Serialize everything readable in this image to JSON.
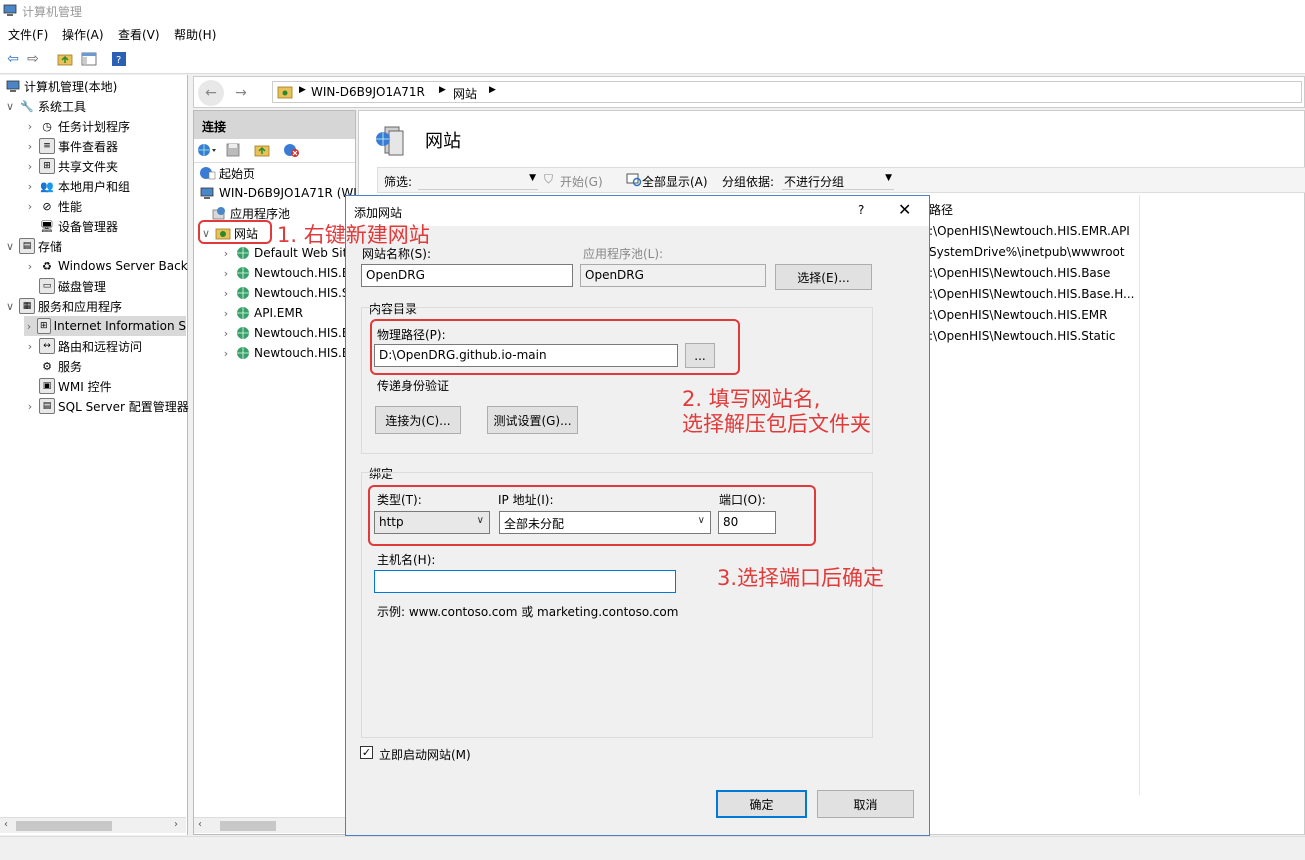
{
  "window": {
    "title": "计算机管理"
  },
  "menu": [
    {
      "label": "文件(F)"
    },
    {
      "label": "操作(A)"
    },
    {
      "label": "查看(V)"
    },
    {
      "label": "帮助(H)"
    }
  ],
  "left_tree": {
    "root": "计算机管理(本地)",
    "system_tools": "系统工具",
    "task_scheduler": "任务计划程序",
    "event_viewer": "事件查看器",
    "shared_folders": "共享文件夹",
    "local_users": "本地用户和组",
    "performance": "性能",
    "device_manager": "设备管理器",
    "storage": "存储",
    "windows_backup": "Windows Server Back",
    "disk_mgmt": "磁盘管理",
    "services_apps": "服务和应用程序",
    "iis": "Internet Information S",
    "routing": "路由和远程访问",
    "services": "服务",
    "wmi": "WMI 控件",
    "sql": "SQL Server 配置管理器"
  },
  "address": {
    "server": "WIN-D6B9JO1A71R",
    "node": "网站"
  },
  "connections": {
    "header": "连接",
    "start_page": "起始页",
    "server": "WIN-D6B9JO1A71R (WI",
    "app_pools": "应用程序池",
    "sites": "网站",
    "site_items": [
      "Default Web Sit",
      "Newtouch.HIS.E",
      "Newtouch.HIS.S",
      "API.EMR",
      "Newtouch.HIS.E",
      "Newtouch.HIS.E"
    ]
  },
  "right": {
    "title": "网站",
    "filter_label": "筛选:",
    "start_label": "开始(G)",
    "show_all_label": "全部显示(A)",
    "group_by_label": "分组依据:",
    "group_by_value": "不进行分组",
    "path_header": "路径",
    "paths": [
      ":\\OpenHIS\\Newtouch.HIS.EMR.API",
      "SystemDrive%\\inetpub\\wwwroot",
      ":\\OpenHIS\\Newtouch.HIS.Base",
      ":\\OpenHIS\\Newtouch.HIS.Base.H...",
      ":\\OpenHIS\\Newtouch.HIS.EMR",
      ":\\OpenHIS\\Newtouch.HIS.Static"
    ]
  },
  "dialog": {
    "title": "添加网站",
    "help": "?",
    "site_name_label": "网站名称(S):",
    "site_name_value": "OpenDRG",
    "app_pool_label": "应用程序池(L):",
    "app_pool_value": "OpenDRG",
    "select_button": "选择(E)...",
    "content_dir_label": "内容目录",
    "physical_path_label": "物理路径(P):",
    "physical_path_value": "D:\\OpenDRG.github.io-main",
    "browse_button": "...",
    "passthrough_label": "传递身份验证",
    "connect_as_button": "连接为(C)...",
    "test_settings_button": "测试设置(G)...",
    "binding_label": "绑定",
    "type_label": "类型(T):",
    "type_value": "http",
    "ip_label": "IP 地址(I):",
    "ip_value": "全部未分配",
    "port_label": "端口(O):",
    "port_value": "80",
    "hostname_label": "主机名(H):",
    "hostname_value": "",
    "example_text": "示例: www.contoso.com 或 marketing.contoso.com",
    "start_now_label": "立即启动网站(M)",
    "start_now_checked": true,
    "ok_button": "确定",
    "cancel_button": "取消"
  },
  "annotations": {
    "step1": "1. 右键新建网站",
    "step2_line1": "2. 填写网站名,",
    "step2_line2": "选择解压包后文件夹",
    "step3": "3.选择端口后确定"
  },
  "colors": {
    "annotation": "#e03a3a",
    "accent": "#0078d7"
  }
}
